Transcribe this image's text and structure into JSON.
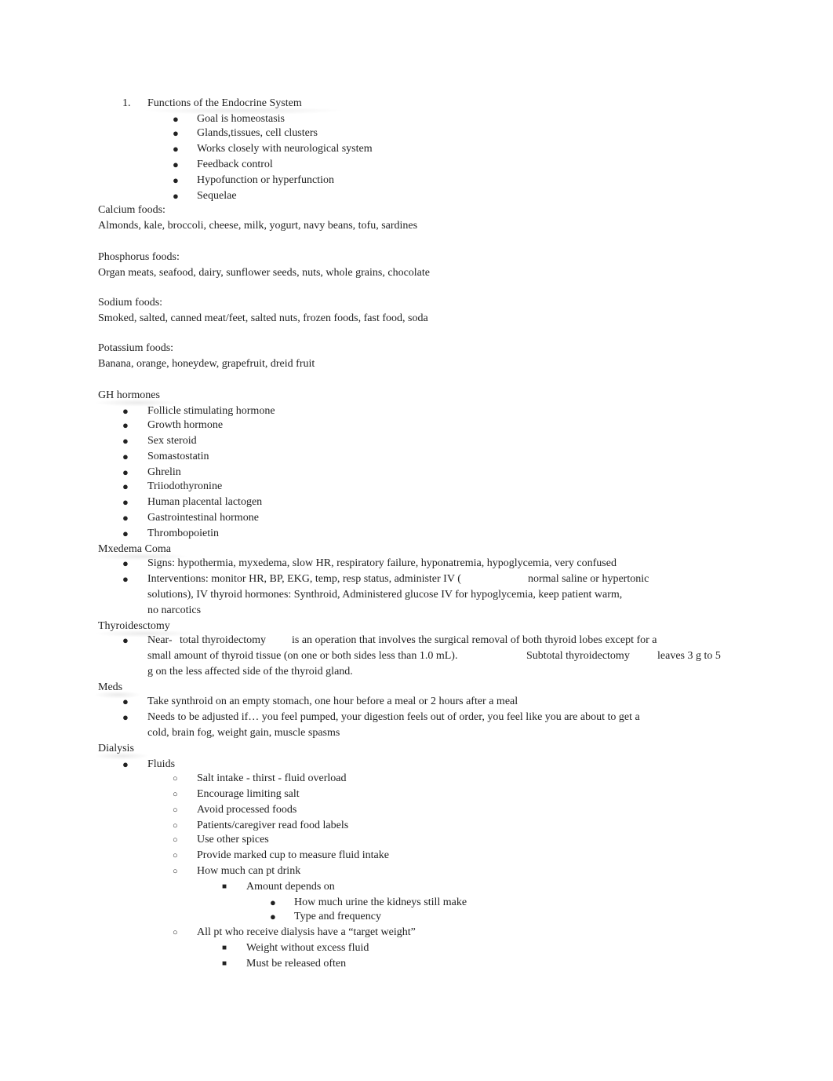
{
  "section1": {
    "number": "1.",
    "title": "Functions of the Endocrine System",
    "items": [
      "Goal is homeostasis",
      "Glands,tissues, cell clusters",
      "Works closely with neurological system",
      "Feedback control",
      "Hypofunction or hyperfunction",
      "Sequelae"
    ]
  },
  "foods": [
    {
      "label": "Calcium foods:",
      "list": "Almonds, kale, broccoli, cheese, milk, yogurt, navy beans, tofu, sardines"
    },
    {
      "label": "Phosphorus foods:",
      "list": "Organ meats, seafood, dairy, sunflower seeds, nuts, whole grains, chocolate"
    },
    {
      "label": "Sodium foods:",
      "list": "Smoked, salted, canned meat/feet, salted nuts, frozen foods, fast food, soda"
    },
    {
      "label": "Potassium foods:",
      "list": "Banana, orange, honeydew, grapefruit, dreid fruit"
    }
  ],
  "gh": {
    "heading": "GH hormones",
    "items": [
      "Follicle stimulating hormone",
      "Growth hormone",
      "Sex steroid",
      "Somastostatin",
      "Ghrelin",
      "Triiodothyronine",
      "Human placental lactogen",
      "Gastrointestinal hormone",
      "Thrombopoietin"
    ]
  },
  "myxedema": {
    "heading": "Mxedema Coma",
    "signs": "Signs: hypothermia, myxedema, slow HR, respiratory failure, hyponatremia, hypoglycemia, very confused",
    "interventions_1a": "Interventions: monitor HR, BP, EKG, temp, resp status, administer IV (",
    "interventions_1b": "normal saline or hypertonic",
    "interventions_2": "solutions), IV thyroid hormones: Synthroid, Administered glucose IV for hypoglycemia, keep patient warm,",
    "interventions_3": "no narcotics"
  },
  "thyroidectomy": {
    "heading": "Thyroidesctomy",
    "l1a": "Near-",
    "l1b": "total thyroidectomy",
    "l1c": "is an operation that involves the surgical removal of both thyroid lobes except for a",
    "l2a": "small amount of thyroid tissue (on one or both sides less than 1.0 mL).",
    "l2b": "Subtotal thyroidectomy",
    "l2c": "leaves 3 g to 5",
    "l3": "g on the less affected side of the thyroid gland."
  },
  "meds": {
    "heading": "Meds",
    "item1": "Take synthroid on an empty stomach, one hour before a meal or 2 hours after a meal",
    "item2a": "Needs to be adjusted if… you feel pumped, your digestion feels out of order, you feel like you are about to get a",
    "item2b": "cold, brain fog, weight gain, muscle spasms"
  },
  "dialysis": {
    "heading": "Dialysis",
    "fluids": "Fluids",
    "sub": [
      "Salt intake - thirst - fluid overload",
      "Encourage limiting salt",
      "Avoid processed foods",
      "Patients/caregiver read food labels",
      "Use other spices",
      "Provide marked cup to measure fluid intake",
      "How much can pt drink"
    ],
    "amount": "Amount depends on",
    "amount_items": [
      "How much urine the kidneys still make",
      "Type and frequency"
    ],
    "target": "All pt who receive dialysis have a “target weight”",
    "target_items": [
      "Weight without excess fluid",
      "Must be released often"
    ]
  },
  "markers": {
    "bullet": "●",
    "hollow": "○",
    "square": "■"
  }
}
